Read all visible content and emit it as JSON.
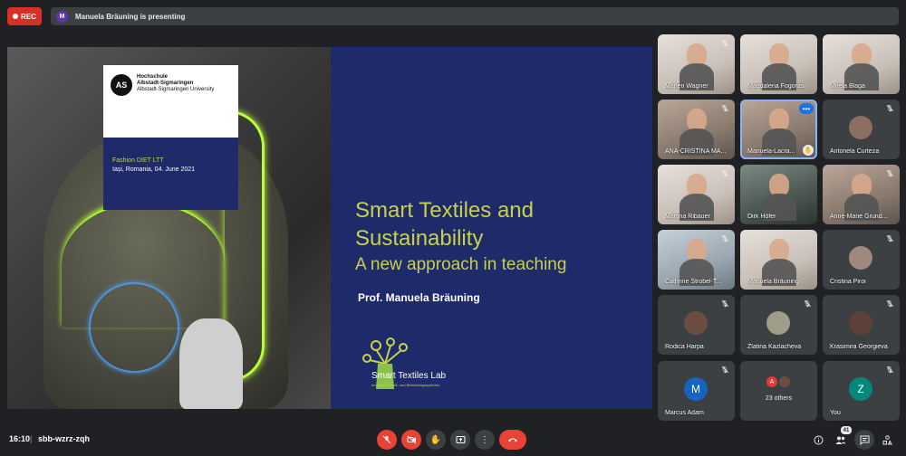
{
  "topbar": {
    "rec_label": "REC",
    "presenter_initial": "M",
    "presenting_text": "Manuela Bräuning is presenting"
  },
  "slide": {
    "logo_mark": "AS",
    "logo_line1": "Hochschule",
    "logo_line2": "Albstadt-Sigmaringen",
    "logo_line3": "Albstadt-Sigmaringen University",
    "event": "Fashion DIET LTT",
    "place_date": "Iași, Romania, 04. June 2021",
    "title": "Smart Textiles and Sustainability",
    "subtitle": "A new approach in teaching",
    "author": "Prof. Manuela Bräuning",
    "lab_name": "Smart Textiles Lab",
    "lab_tagline": "Innovative Textil- und Bekleidungssysteme"
  },
  "participants": [
    {
      "name": "Marlen Wagner",
      "style": "photo light",
      "muted": true
    },
    {
      "name": "Magdalena Fogorasi",
      "style": "photo light",
      "muted": false
    },
    {
      "name": "Mirela Blaga",
      "style": "photo light",
      "muted": false
    },
    {
      "name": "ANA-CRISTINA MA...",
      "style": "photo",
      "muted": true
    },
    {
      "name": "Manuela-Lacra...",
      "style": "photo active",
      "muted": false,
      "more": "•••",
      "hand": "✋"
    },
    {
      "name": "Antonela Curteza",
      "style": "avatar",
      "muted": true,
      "avatar_color": "#8d6e63",
      "initial": ""
    },
    {
      "name": "Martina Ribauer",
      "style": "photo light",
      "muted": true
    },
    {
      "name": "Dirk Höfer",
      "style": "photo dark",
      "muted": false
    },
    {
      "name": "Anne-Marie Grund...",
      "style": "photo",
      "muted": true
    },
    {
      "name": "Cathrine Strobel-T...",
      "style": "photo blue",
      "muted": true
    },
    {
      "name": "Manuela Bräuning",
      "style": "photo light",
      "muted": false
    },
    {
      "name": "Cristina Piroi",
      "style": "avatar",
      "muted": true,
      "avatar_color": "#a1887f",
      "initial": ""
    },
    {
      "name": "Rodica Harpa",
      "style": "avatar",
      "muted": true,
      "avatar_color": "#6d4c41",
      "initial": ""
    },
    {
      "name": "Zlatina Kazlacheva",
      "style": "avatar",
      "muted": true,
      "avatar_color": "#9e9d8a",
      "initial": ""
    },
    {
      "name": "Krasimira Georgieva",
      "style": "avatar",
      "muted": true,
      "avatar_color": "#5d4037",
      "initial": ""
    },
    {
      "name": "Marcus Adam",
      "style": "avatar",
      "muted": true,
      "avatar_color": "#1565c0",
      "initial": "M"
    },
    {
      "name": "23 others",
      "style": "others",
      "muted": false,
      "others_initial": "A"
    },
    {
      "name": "You",
      "style": "avatar",
      "muted": true,
      "avatar_color": "#00897b",
      "initial": "Z"
    }
  ],
  "bottombar": {
    "time": "16:10",
    "separator": "|",
    "meeting_code": "sbb-wzrz-zqh",
    "participant_count": "41"
  },
  "icons": {
    "mic_off": "mic-off-icon",
    "cam_off": "videocam-off-icon",
    "raise_hand": "hand-icon",
    "present": "present-icon",
    "more": "more-vert-icon",
    "leave": "call-end-icon",
    "info": "info-icon",
    "people": "people-icon",
    "chat": "chat-icon",
    "activities": "activities-icon"
  },
  "colors": {
    "accent_red": "#ea4335",
    "slide_bg": "#1f2a6b",
    "slide_text": "#c7d14a",
    "active_border": "#8ab4f8"
  }
}
